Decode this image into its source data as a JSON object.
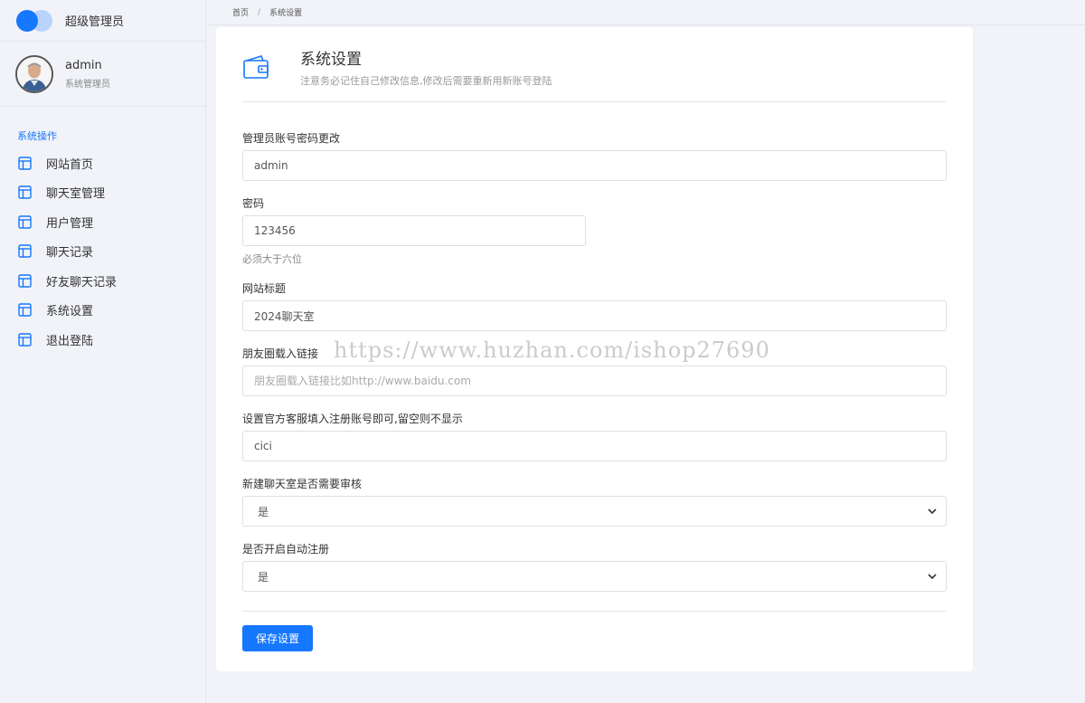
{
  "brand": {
    "title": "超级管理员",
    "primary_color": "#1677ff",
    "secondary_color": "#b9d3fb"
  },
  "user": {
    "name": "admin",
    "role": "系统管理员"
  },
  "sidebar": {
    "section": "系统操作",
    "items": [
      {
        "label": "网站首页",
        "icon": "layout-icon"
      },
      {
        "label": "聊天室管理",
        "icon": "layout-icon"
      },
      {
        "label": "用户管理",
        "icon": "layout-icon"
      },
      {
        "label": "聊天记录",
        "icon": "layout-icon"
      },
      {
        "label": "好友聊天记录",
        "icon": "layout-icon"
      },
      {
        "label": "系统设置",
        "icon": "layout-icon"
      },
      {
        "label": "退出登陆",
        "icon": "layout-icon"
      }
    ]
  },
  "breadcrumb": {
    "home": "首页",
    "separator": "/",
    "current": "系统设置"
  },
  "page": {
    "title": "系统设置",
    "subtitle": "注意务必记住自己修改信息,修改后需要重新用新账号登陆",
    "icon": "wallet-icon"
  },
  "form": {
    "account_label": "管理员账号密码更改",
    "account_value": "admin",
    "password_label": "密码",
    "password_value": "123456",
    "password_help": "必须大于六位",
    "site_title_label": "网站标题",
    "site_title_value": "2024聊天室",
    "moments_label": "朋友圈载入链接",
    "moments_placeholder": "朋友圈载入链接比如http://www.baidu.com",
    "service_label": "设置官方客服填入注册账号即可,留空则不显示",
    "service_value": "cici",
    "review_label": "新建聊天室是否需要审核",
    "review_value": "是",
    "autoreg_label": "是否开启自动注册",
    "autoreg_value": "是",
    "save_label": "保存设置"
  },
  "watermark": "https://www.huzhan.com/ishop27690"
}
